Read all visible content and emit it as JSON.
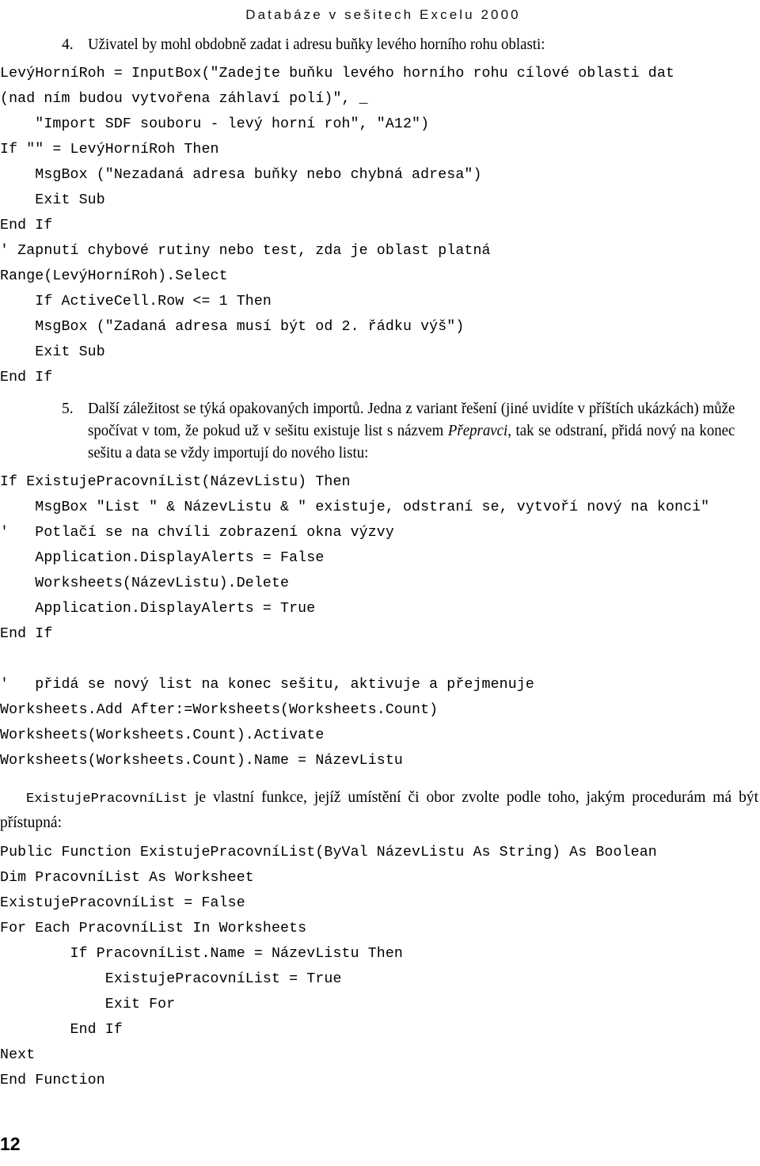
{
  "header": {
    "running_title": "Databáze v sešitech Excelu 2000"
  },
  "items": [
    {
      "number": "4.",
      "text": "Uživatel by mohl obdobně zadat i adresu buňky levého horního rohu oblasti:"
    }
  ],
  "code_block_1": [
    "LevýHorníRoh = InputBox(\"Zadejte buňku levého horního rohu cílové oblasti dat",
    "(nad ním budou vytvořena záhlaví polí)\", _",
    "    \"Import SDF souboru - levý horní roh\", \"A12\")",
    "If \"\" = LevýHorníRoh Then",
    "    MsgBox (\"Nezadaná adresa buňky nebo chybná adresa\")",
    "    Exit Sub",
    "End If",
    "' Zapnutí chybové rutiny nebo test, zda je oblast platná",
    "Range(LevýHorníRoh).Select",
    "    If ActiveCell.Row <= 1 Then",
    "    MsgBox (\"Zadaná adresa musí být od 2. řádku výš\")",
    "    Exit Sub",
    "End If"
  ],
  "item5": {
    "number": "5.",
    "part1": "Další záležitost se týká opakovaných importů. Jedna z variant řešení (jiné uvidíte v příštích ukázkách) může spočívat v tom, že pokud už v sešitu existuje list s názvem ",
    "emphasis": "Přepravci",
    "part2": ", tak se odstraní, přidá nový na konec sešitu a data se vždy importují do nového listu:"
  },
  "code_block_2": [
    "If ExistujePracovníList(NázevListu) Then",
    "    MsgBox \"List \" & NázevListu & \" existuje, odstraní se, vytvoří nový na konci\"",
    "'   Potlačí se na chvíli zobrazení okna výzvy",
    "    Application.DisplayAlerts = False",
    "    Worksheets(NázevListu).Delete",
    "    Application.DisplayAlerts = True",
    "End If",
    "",
    "'   přidá se nový list na konec sešitu, aktivuje a přejmenuje",
    "Worksheets.Add After:=Worksheets(Worksheets.Count)",
    "Worksheets(Worksheets.Count).Activate",
    "Worksheets(Worksheets.Count).Name = NázevListu"
  ],
  "paragraph": {
    "mono_lead": "ExistujePracovníList",
    "rest": " je vlastní funkce, jejíž umístění či obor zvolte podle toho, jakým procedurám má být přístupná:"
  },
  "code_block_3": [
    "Public Function ExistujePracovníList(ByVal NázevListu As String) As Boolean",
    "Dim PracovníList As Worksheet",
    "ExistujePracovníList = False",
    "For Each PracovníList In Worksheets",
    "        If PracovníList.Name = NázevListu Then",
    "            ExistujePracovníList = True",
    "            Exit For",
    "        End If",
    "Next",
    "End Function"
  ],
  "folio": {
    "page_number": "12"
  }
}
